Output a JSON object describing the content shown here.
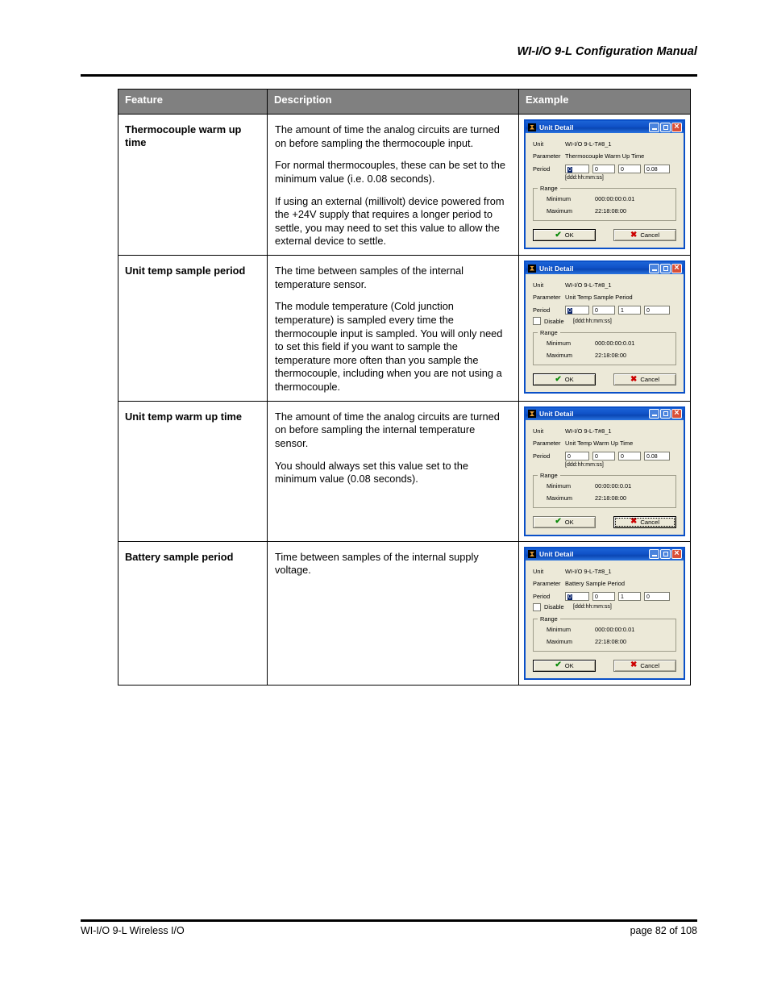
{
  "header": {
    "title": "WI-I/O 9-L Configuration Manual"
  },
  "footer": {
    "left": "WI-I/O 9-L Wireless I/O",
    "right": "page 82 of 108"
  },
  "table": {
    "columns": [
      "Feature",
      "Description",
      "Example"
    ],
    "rows": [
      {
        "feature": "Thermocouple warm up time",
        "description": [
          "The amount of time the analog circuits are turned on before sampling the thermocouple input.",
          "For normal thermocouples, these can be set to the minimum value (i.e. 0.08 seconds).",
          "If using an external (millivolt) device powered from the +24V supply that requires a longer period to settle, you may need to set this value to allow the external device to settle."
        ],
        "dialog": {
          "title": "Unit Detail",
          "unit_label": "Unit",
          "unit_value": "WI-I/O 9-L-T#8_1",
          "parameter_label": "Parameter",
          "parameter_value": "Thermocouple Warm Up Time",
          "period_label": "Period",
          "period_fields": [
            "0",
            "0",
            "0",
            "0.08"
          ],
          "period_selected_index": 0,
          "format_hint": "[ddd:hh:mm:ss]",
          "has_disable": false,
          "disable_label": "Disable",
          "range_title": "Range",
          "minimum_label": "Minimum",
          "minimum_value": "000:00:00:0.01",
          "maximum_label": "Maximum",
          "maximum_value": "22:18:08:00",
          "ok_label": "OK",
          "cancel_label": "Cancel",
          "focused_button": "ok"
        }
      },
      {
        "feature": "Unit temp sample period",
        "description": [
          "The time between samples of the internal temperature sensor.",
          "The module temperature (Cold junction temperature) is sampled every time the thermocouple input is sampled. You will only need to set this field if you want to sample the temperature more often than you sample the thermocouple, including when you are not using a thermocouple."
        ],
        "dialog": {
          "title": "Unit Detail",
          "unit_label": "Unit",
          "unit_value": "WI-I/O 9-L-T#8_1",
          "parameter_label": "Parameter",
          "parameter_value": "Unit Temp Sample Period",
          "period_label": "Period",
          "period_fields": [
            "0",
            "0",
            "1",
            "0"
          ],
          "period_selected_index": 0,
          "format_hint": "[ddd:hh:mm:ss]",
          "has_disable": true,
          "disable_label": "Disable",
          "range_title": "Range",
          "minimum_label": "Minimum",
          "minimum_value": "000:00:00:0.01",
          "maximum_label": "Maximum",
          "maximum_value": "22:18:08:00",
          "ok_label": "OK",
          "cancel_label": "Cancel",
          "focused_button": "ok"
        }
      },
      {
        "feature": "Unit temp warm up time",
        "description": [
          "The amount of time the analog circuits are turned on before sampling the internal temperature sensor.",
          "You should always set this value set to the minimum value (0.08 seconds)."
        ],
        "dialog": {
          "title": "Unit Detail",
          "unit_label": "Unit",
          "unit_value": "WI-I/O 9-L-T#8_1",
          "parameter_label": "Parameter",
          "parameter_value": "Unit Temp Warm Up Time",
          "period_label": "Period",
          "period_fields": [
            "0",
            "0",
            "0",
            "0.08"
          ],
          "period_selected_index": -1,
          "format_hint": "[ddd:hh:mm:ss]",
          "has_disable": false,
          "disable_label": "Disable",
          "range_title": "Range",
          "minimum_label": "Minimum",
          "minimum_value": "00:00:00:0.01",
          "maximum_label": "Maximum",
          "maximum_value": "22:18:08:00",
          "ok_label": "OK",
          "cancel_label": "Cancel",
          "focused_button": "cancel"
        }
      },
      {
        "feature": "Battery  sample period",
        "description": [
          "Time between samples of the internal supply voltage."
        ],
        "dialog": {
          "title": "Unit Detail",
          "unit_label": "Unit",
          "unit_value": "WI-I/O 9-L-T#8_1",
          "parameter_label": "Parameter",
          "parameter_value": "Battery Sample Period",
          "period_label": "Period",
          "period_fields": [
            "0",
            "0",
            "1",
            "0"
          ],
          "period_selected_index": 0,
          "format_hint": "[ddd:hh:mm:ss]",
          "has_disable": true,
          "disable_label": "Disable",
          "range_title": "Range",
          "minimum_label": "Minimum",
          "minimum_value": "000:00:00:0.01",
          "maximum_label": "Maximum",
          "maximum_value": "22:18:08:00",
          "ok_label": "OK",
          "cancel_label": "Cancel",
          "focused_button": "ok"
        }
      }
    ]
  },
  "colors": {
    "header_row_bg": "#808080",
    "titlebar_blue": "#0a50c8",
    "dialog_face": "#ece9d8",
    "selection_blue": "#0a246a",
    "ok_tick_green": "#0a8a0a",
    "cancel_cross_red": "#cc0000"
  }
}
